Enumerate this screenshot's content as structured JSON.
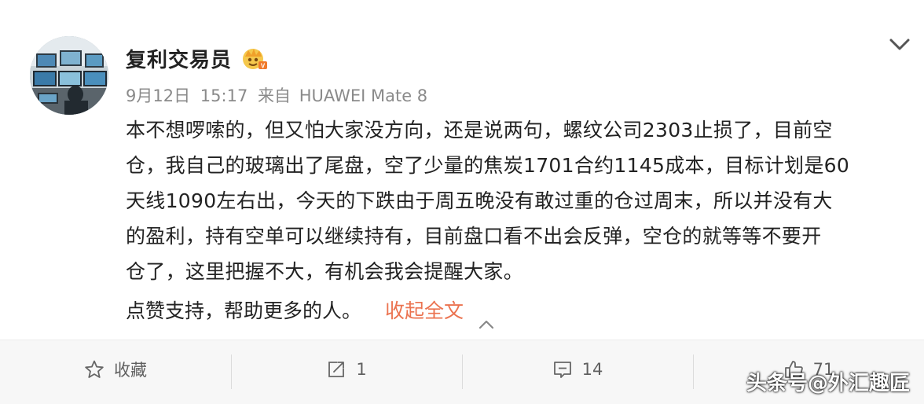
{
  "author": {
    "name": "复利交易员",
    "badge_icon": "vip-crown-icon"
  },
  "meta": {
    "date": "9月12日",
    "time": "15:17",
    "source_prefix": "来自",
    "device": "HUAWEI Mate 8"
  },
  "content": {
    "lines": [
      "本不想啰嗦的，但又怕大家没方向，还是说两句，螺纹公司2303止损了，目前空",
      "仓，我自己的玻璃出了尾盘，空了少量的焦炭1701合约1145成本，目标计划是60",
      "天线1090左右出，今天的下跌由于周五晚没有敢过重的仓过周末，所以并没有大",
      "的盈利，持有空单可以继续持有，目前盘口看不出会反弹，空仓的就等等不要开",
      "仓了，这里把握不大，有机会我会提醒大家。"
    ],
    "footer_text": "点赞支持，帮助更多的人。",
    "collapse_label": "收起全文",
    "link_color": "#eb7350"
  },
  "actions": {
    "favorite_label": "收藏",
    "repost_count": "1",
    "comment_count": "14",
    "like_count": "71"
  },
  "watermark": "头条号@外汇趣匠"
}
